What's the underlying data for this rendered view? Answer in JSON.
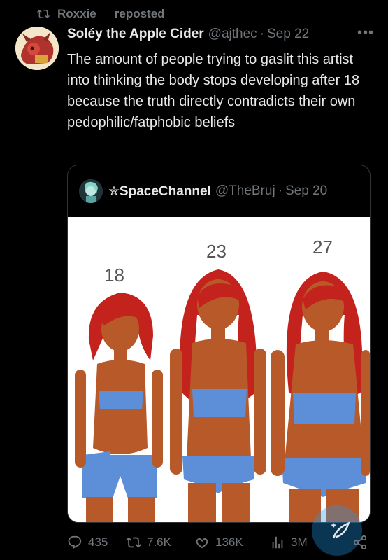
{
  "repost": {
    "user": "Roxxie",
    "label": "reposted"
  },
  "tweet": {
    "author_name": "Soléy the Apple Cider",
    "handle": "@ajthec",
    "sep": "·",
    "date": "Sep 22",
    "more": "•••",
    "text": "The amount of people trying to gaslit this artist into thinking the body stops developing after 18 because the truth directly contradicts their own pedophilic/fatphobic beliefs"
  },
  "quote": {
    "author_name": "✮SpaceChannel",
    "handle": "@TheBruj",
    "sep": "·",
    "date": "Sep 20",
    "image_labels": [
      "18",
      "23",
      "27"
    ]
  },
  "actions": {
    "replies": "435",
    "reposts": "7.6K",
    "likes": "136K",
    "views": "3M"
  },
  "colors": {
    "background": "#000000",
    "text": "#e7e9ea",
    "muted": "#71767b",
    "accent": "#1d9bf0",
    "hair": "#c4221d",
    "skin": "#b8592a",
    "swimsuit": "#5c8fd8"
  }
}
